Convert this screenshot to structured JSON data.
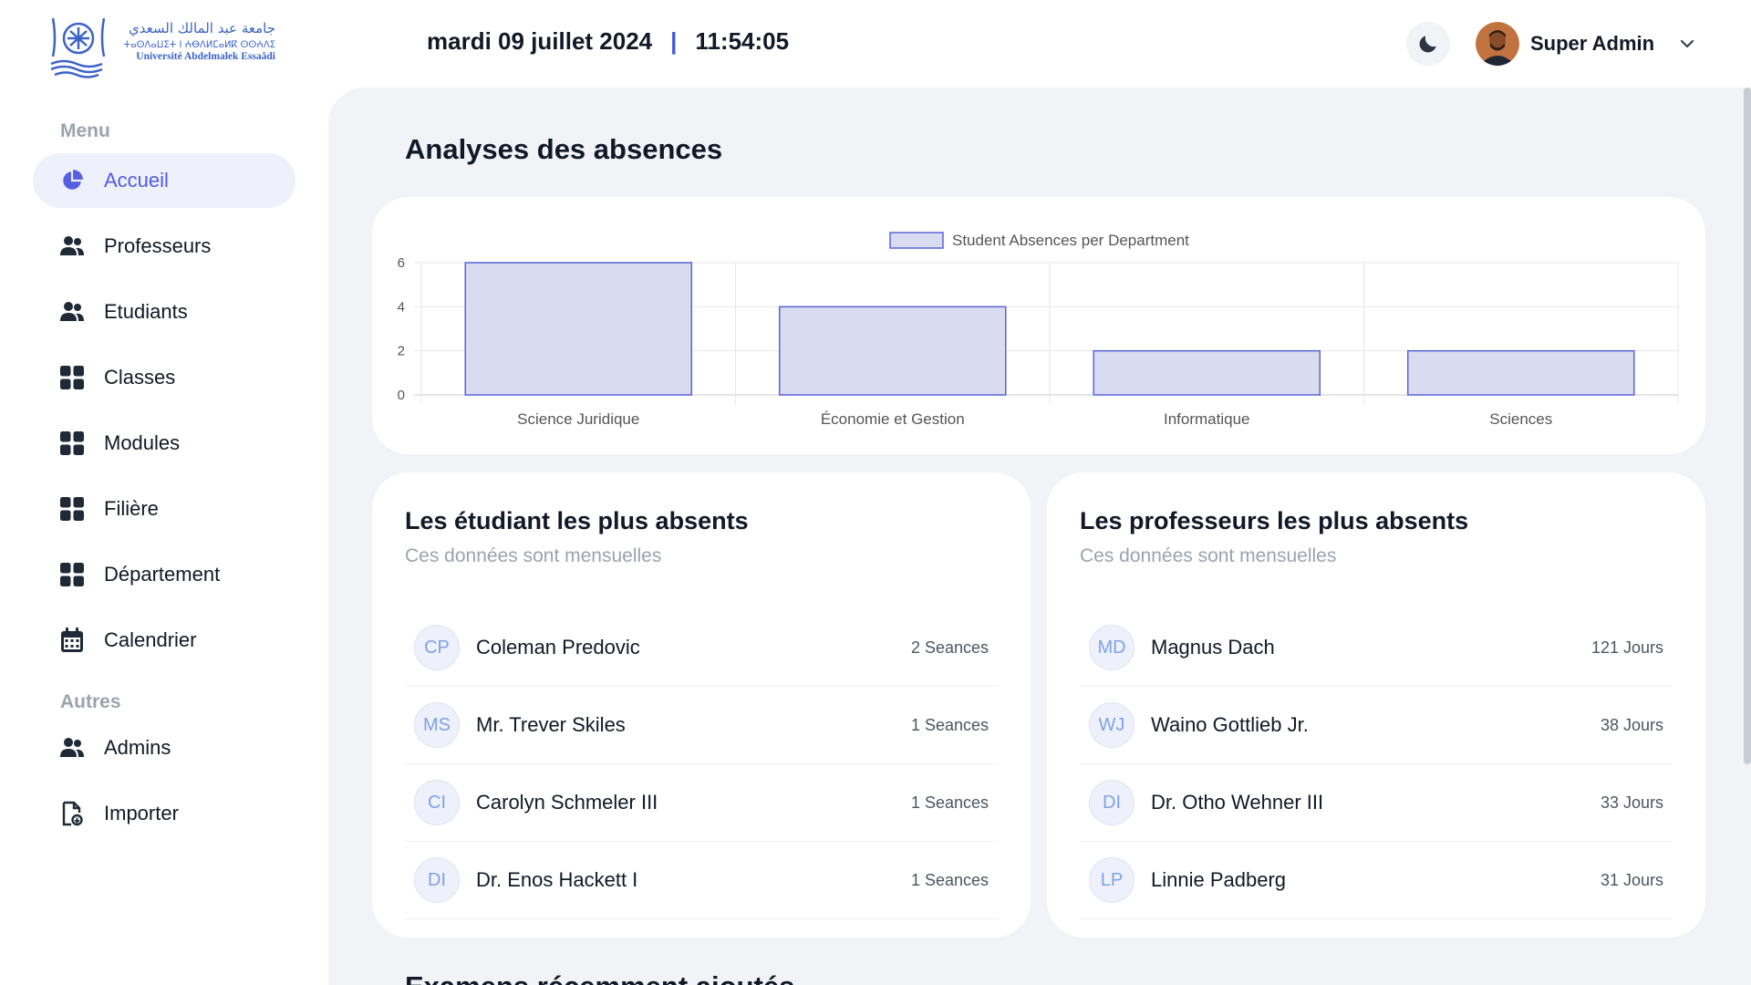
{
  "header": {
    "logo": {
      "arabic": "جامعة عبد المالك السعدي",
      "amazigh": "ⵜⴰⵙⴷⴰⵡⵉⵜ ⵏ ⵄⴱⴷⵍⵎⴰⵍⴽ ⵙⵙⵄⴷⵉ",
      "french": "Université Abdelmalek Essaâdi",
      "brand_color": "#3b63c9"
    },
    "date": "mardi 09 juillet 2024",
    "separator": "|",
    "time": "11:54:05",
    "theme_icon": "moon-icon",
    "user_name": "Super Admin"
  },
  "sidebar": {
    "menu_title": "Menu",
    "menu_items": [
      {
        "label": "Accueil",
        "icon": "pie-chart-icon",
        "active": true
      },
      {
        "label": "Professeurs",
        "icon": "users-icon"
      },
      {
        "label": "Etudiants",
        "icon": "users-icon"
      },
      {
        "label": "Classes",
        "icon": "grid-icon"
      },
      {
        "label": "Modules",
        "icon": "grid-icon"
      },
      {
        "label": "Filière",
        "icon": "grid-icon"
      },
      {
        "label": "Département",
        "icon": "grid-icon"
      },
      {
        "label": "Calendrier",
        "icon": "calendar-icon"
      }
    ],
    "other_title": "Autres",
    "other_items": [
      {
        "label": "Admins",
        "icon": "users-icon"
      },
      {
        "label": "Importer",
        "icon": "file-import-icon"
      }
    ]
  },
  "main": {
    "title": "Analyses des absences",
    "students_card": {
      "title": "Les étudiant les plus absents",
      "subtitle": "Ces données sont mensuelles",
      "rows": [
        {
          "initials": "CP",
          "name": "Coleman Predovic",
          "count": "2 Seances"
        },
        {
          "initials": "MS",
          "name": "Mr. Trever Skiles",
          "count": "1 Seances"
        },
        {
          "initials": "CI",
          "name": "Carolyn Schmeler III",
          "count": "1 Seances"
        },
        {
          "initials": "DI",
          "name": "Dr. Enos Hackett I",
          "count": "1 Seances"
        }
      ]
    },
    "profs_card": {
      "title": "Les professeurs les plus absents",
      "subtitle": "Ces données sont mensuelles",
      "rows": [
        {
          "initials": "MD",
          "name": "Magnus Dach",
          "count": "121 Jours"
        },
        {
          "initials": "WJ",
          "name": "Waino Gottlieb Jr.",
          "count": "38 Jours"
        },
        {
          "initials": "DI",
          "name": "Dr. Otho Wehner III",
          "count": "33 Jours"
        },
        {
          "initials": "LP",
          "name": "Linnie Padberg",
          "count": "31 Jours"
        }
      ]
    },
    "next_section_title": "Examens récemment ajoutés"
  },
  "colors": {
    "accent": "#4f5ce6",
    "active_bg": "#eef0fb",
    "main_bg": "#f1f3f7",
    "bar_fill": "#d9dbf0",
    "bar_stroke": "#5865d6"
  },
  "chart_data": {
    "type": "bar",
    "legend": "Student Absences per Department",
    "legend_position": "top-center",
    "categories": [
      "Science Juridique",
      "Économie et Gestion",
      "Informatique",
      "Sciences"
    ],
    "series": [
      {
        "name": "Student Absences per Department",
        "values": [
          6,
          4,
          2,
          2
        ]
      }
    ],
    "ylim": [
      0,
      6
    ],
    "yticks": [
      0,
      2,
      4,
      6
    ],
    "grid": true
  }
}
